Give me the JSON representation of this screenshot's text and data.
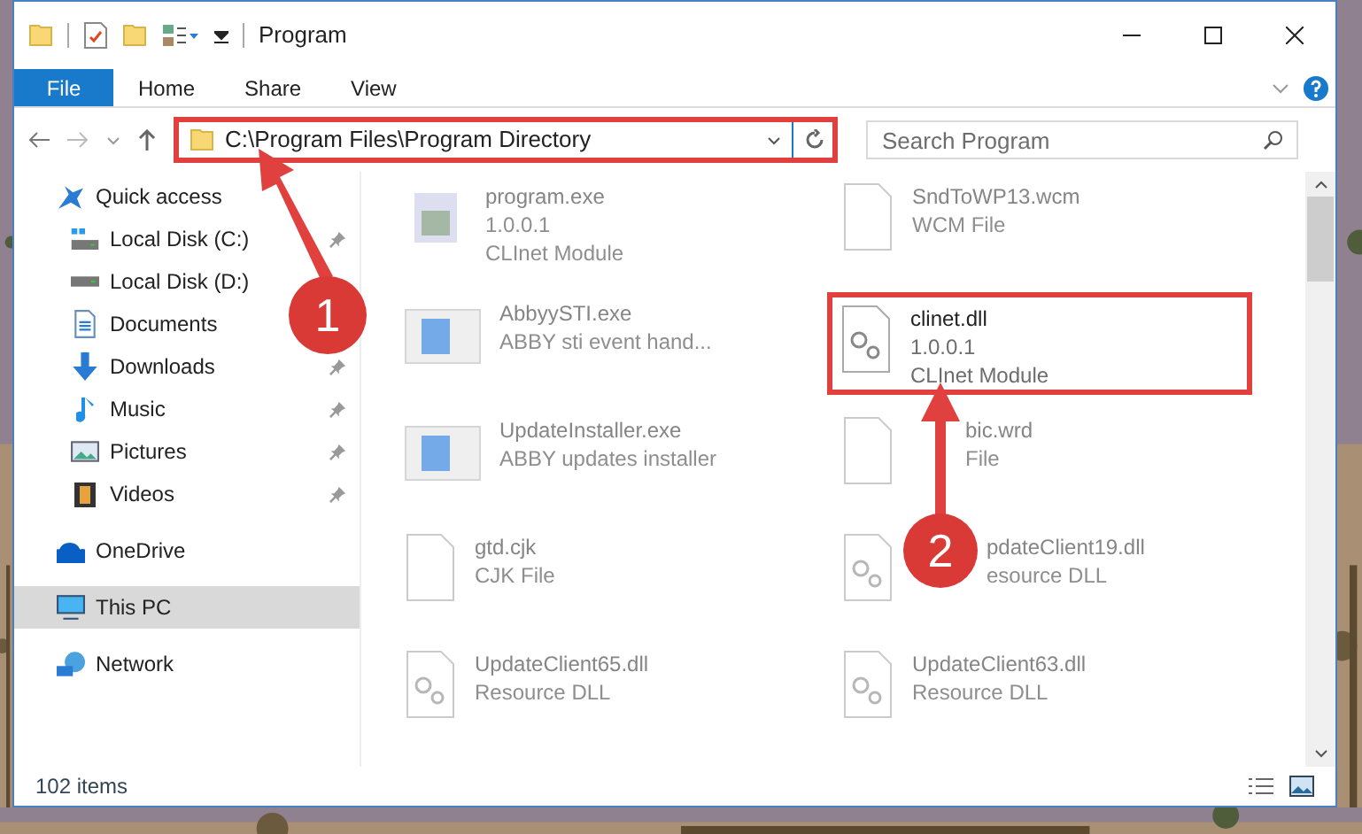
{
  "window": {
    "title": "Program"
  },
  "ribbon_tabs": [
    {
      "label": "File",
      "selected": true
    },
    {
      "label": "Home",
      "selected": false
    },
    {
      "label": "Share",
      "selected": false
    },
    {
      "label": "View",
      "selected": false
    }
  ],
  "address_bar": {
    "path": "C:\\Program Files\\Program Directory",
    "highlighted": true
  },
  "search": {
    "placeholder": "Search Program"
  },
  "sidebar": {
    "items": [
      {
        "label": "Quick access",
        "kind": "star",
        "selected": false,
        "children": [
          {
            "label": "Local Disk (C:)",
            "kind": "disk-c",
            "pinned": true
          },
          {
            "label": "Local Disk (D:)",
            "kind": "disk"
          },
          {
            "label": "Documents",
            "kind": "documents"
          },
          {
            "label": "Downloads",
            "kind": "downloads",
            "pinned": true
          },
          {
            "label": "Music",
            "kind": "music",
            "pinned": true
          },
          {
            "label": "Pictures",
            "kind": "pictures",
            "pinned": true
          },
          {
            "label": "Videos",
            "kind": "videos",
            "pinned": true
          }
        ]
      },
      {
        "label": "OneDrive",
        "kind": "cloud",
        "selected": false
      },
      {
        "label": "This PC",
        "kind": "pc",
        "selected": true
      },
      {
        "label": "Network",
        "kind": "network",
        "selected": false
      }
    ]
  },
  "files": [
    {
      "name": "program.exe",
      "lines": [
        "1.0.0.1",
        "CLInet Module"
      ],
      "kind": "installer",
      "faded": true,
      "highlighted": false
    },
    {
      "name": "SndToWP13.wcm",
      "lines": [
        "WCM File"
      ],
      "kind": "blank",
      "faded": true,
      "highlighted": false
    },
    {
      "name": "AbbyySTI.exe",
      "lines": [
        "ABBY sti event hand..."
      ],
      "kind": "app",
      "faded": true,
      "highlighted": false
    },
    {
      "name": "clinet.dll",
      "lines": [
        "1.0.0.1",
        "CLInet Module"
      ],
      "kind": "dll",
      "faded": false,
      "highlighted": true
    },
    {
      "name": "UpdateInstaller.exe",
      "lines": [
        "ABBY updates installer"
      ],
      "kind": "app",
      "faded": true,
      "highlighted": false
    },
    {
      "name": "bic.wrd",
      "lines": [
        "File"
      ],
      "kind": "blank",
      "faded": true,
      "highlighted": false
    },
    {
      "name": "gtd.cjk",
      "lines": [
        "CJK File"
      ],
      "kind": "blank",
      "faded": true,
      "highlighted": false
    },
    {
      "name": "pdateClient19.dll",
      "lines": [
        "esource DLL"
      ],
      "kind": "dll",
      "faded": true,
      "highlighted": false
    },
    {
      "name": "UpdateClient65.dll",
      "lines": [
        "Resource DLL"
      ],
      "kind": "dll",
      "faded": true,
      "highlighted": false
    },
    {
      "name": "UpdateClient63.dll",
      "lines": [
        "Resource DLL"
      ],
      "kind": "dll",
      "faded": true,
      "highlighted": false
    }
  ],
  "status_bar": {
    "count": "102 items"
  },
  "annotations": [
    {
      "label": "1"
    },
    {
      "label": "2"
    }
  ]
}
